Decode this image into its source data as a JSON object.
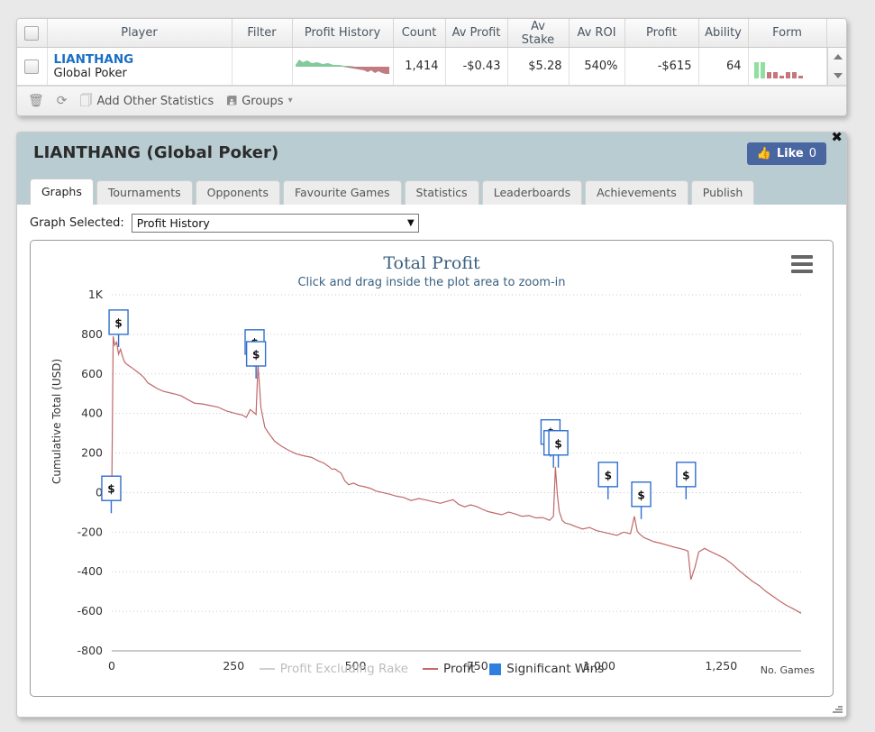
{
  "grid": {
    "columns": [
      "",
      "Player",
      "Filter",
      "Profit History",
      "Count",
      "Av Profit",
      "Av Stake",
      "Av ROI",
      "Profit",
      "Ability",
      "Form"
    ],
    "rows": [
      {
        "player_name": "LIANTHANG",
        "player_site": "Global Poker",
        "filter": "",
        "count": "1,414",
        "av_profit": "-$0.43",
        "av_stake": "$5.28",
        "av_roi": "540%",
        "profit": "-$615",
        "ability": "64"
      }
    ],
    "toolbar": {
      "delete_icon": "trash-icon",
      "refresh_icon": "refresh-icon",
      "add_stats_icon": "copy-icon",
      "add_stats_label": "Add Other Statistics",
      "groups_icon": "floppy-icon",
      "groups_label": "Groups",
      "groups_caret": "▾"
    }
  },
  "player_panel": {
    "title": "LIANTHANG (Global Poker)",
    "like_label": "Like",
    "like_count": "0",
    "close_label": "✖",
    "tabs": [
      {
        "label": "Graphs",
        "active": true
      },
      {
        "label": "Tournaments",
        "active": false
      },
      {
        "label": "Opponents",
        "active": false
      },
      {
        "label": "Favourite Games",
        "active": false
      },
      {
        "label": "Statistics",
        "active": false
      },
      {
        "label": "Leaderboards",
        "active": false
      },
      {
        "label": "Achievements",
        "active": false
      },
      {
        "label": "Publish",
        "active": false
      }
    ],
    "graph_select_label": "Graph Selected:",
    "graph_select_value": "Profit History",
    "graph_select_caret": "▼",
    "menu_icon": "hamburger-icon"
  },
  "chart_data": {
    "type": "line",
    "title": "Total Profit",
    "subtitle": "Click and drag inside the plot area to zoom-in",
    "xlabel": "No. Games",
    "ylabel": "Cumulative Total (USD)",
    "xlim": [
      0,
      1414
    ],
    "ylim": [
      -800,
      1000
    ],
    "xticks": [
      0,
      250,
      500,
      750,
      1000,
      1250
    ],
    "xticklabels": [
      "0",
      "250",
      "500",
      "750",
      "1,000",
      "1,250"
    ],
    "yticks": [
      1000,
      800,
      600,
      400,
      200,
      0,
      -200,
      -400,
      -600,
      -800
    ],
    "yticklabels": [
      "1K",
      "800",
      "600",
      "400",
      "200",
      "0",
      "-200",
      "-400",
      "-600",
      "-800"
    ],
    "grid": true,
    "legend_position": "bottom",
    "legend": [
      {
        "name": "Profit Excluding Rake",
        "color": "#bdbdbd",
        "marker": "line",
        "enabled": false
      },
      {
        "name": "Profit",
        "color": "#c0686a",
        "marker": "line",
        "enabled": true
      },
      {
        "name": "Significant Wins",
        "color": "#2f7fe0",
        "marker": "square",
        "enabled": true
      }
    ],
    "series": [
      {
        "name": "Profit",
        "color": "#c0686a",
        "x": [
          0,
          3,
          6,
          10,
          14,
          18,
          22,
          26,
          30,
          36,
          42,
          50,
          58,
          66,
          74,
          84,
          94,
          106,
          118,
          130,
          142,
          156,
          170,
          186,
          202,
          218,
          236,
          254,
          268,
          276,
          284,
          290,
          296,
          300,
          306,
          314,
          322,
          334,
          348,
          362,
          378,
          394,
          410,
          424,
          436,
          446,
          452,
          458,
          464,
          470,
          478,
          486,
          496,
          506,
          518,
          530,
          542,
          556,
          570,
          584,
          598,
          614,
          630,
          646,
          660,
          674,
          688,
          700,
          712,
          724,
          736,
          748,
          760,
          772,
          786,
          800,
          814,
          828,
          842,
          856,
          870,
          884,
          898,
          906,
          910,
          914,
          918,
          924,
          930,
          940,
          952,
          966,
          980,
          994,
          1008,
          1022,
          1036,
          1050,
          1064,
          1072,
          1078,
          1084,
          1092,
          1100,
          1112,
          1126,
          1140,
          1154,
          1168,
          1176,
          1182,
          1188,
          1196,
          1204,
          1216,
          1230,
          1244,
          1258,
          1272,
          1286,
          1300,
          1314,
          1328,
          1342,
          1356,
          1370,
          1384,
          1400,
          1414
        ],
        "y": [
          -20,
          790,
          745,
          760,
          700,
          725,
          690,
          662,
          650,
          640,
          630,
          615,
          600,
          582,
          555,
          540,
          525,
          512,
          505,
          498,
          490,
          470,
          452,
          448,
          440,
          432,
          412,
          400,
          392,
          380,
          420,
          408,
          395,
          650,
          430,
          330,
          300,
          260,
          235,
          215,
          196,
          186,
          178,
          160,
          148,
          130,
          118,
          120,
          108,
          100,
          60,
          40,
          48,
          36,
          30,
          22,
          8,
          0,
          -8,
          -18,
          -24,
          -40,
          -30,
          -38,
          -46,
          -54,
          -44,
          -36,
          -60,
          -72,
          -62,
          -70,
          -84,
          -96,
          -104,
          -112,
          -98,
          -108,
          -120,
          -116,
          -128,
          -126,
          -140,
          -120,
          130,
          -10,
          -96,
          -140,
          -154,
          -160,
          -172,
          -184,
          -176,
          -192,
          -200,
          -208,
          -216,
          -200,
          -208,
          -120,
          -196,
          -212,
          -228,
          -236,
          -248,
          -256,
          -266,
          -276,
          -284,
          -290,
          -296,
          -440,
          -380,
          -300,
          -282,
          -300,
          -316,
          -334,
          -360,
          -392,
          -420,
          -448,
          -470,
          -500,
          -524,
          -548,
          -570,
          -590,
          -610
        ]
      }
    ],
    "markers": [
      {
        "label": "$",
        "x": 14,
        "y": 800
      },
      {
        "label": "$",
        "x": 293,
        "y": 700
      },
      {
        "label": "$",
        "x": 296,
        "y": 640
      },
      {
        "label": "$",
        "x": 900,
        "y": 245
      },
      {
        "label": "$",
        "x": 906,
        "y": 190
      },
      {
        "label": "$",
        "x": 916,
        "y": 190
      },
      {
        "label": "$",
        "x": 1018,
        "y": 30
      },
      {
        "label": "$",
        "x": 1086,
        "y": -70
      },
      {
        "label": "$",
        "x": 1178,
        "y": 30
      },
      {
        "label": "$",
        "x": -1,
        "y": -40
      }
    ]
  }
}
